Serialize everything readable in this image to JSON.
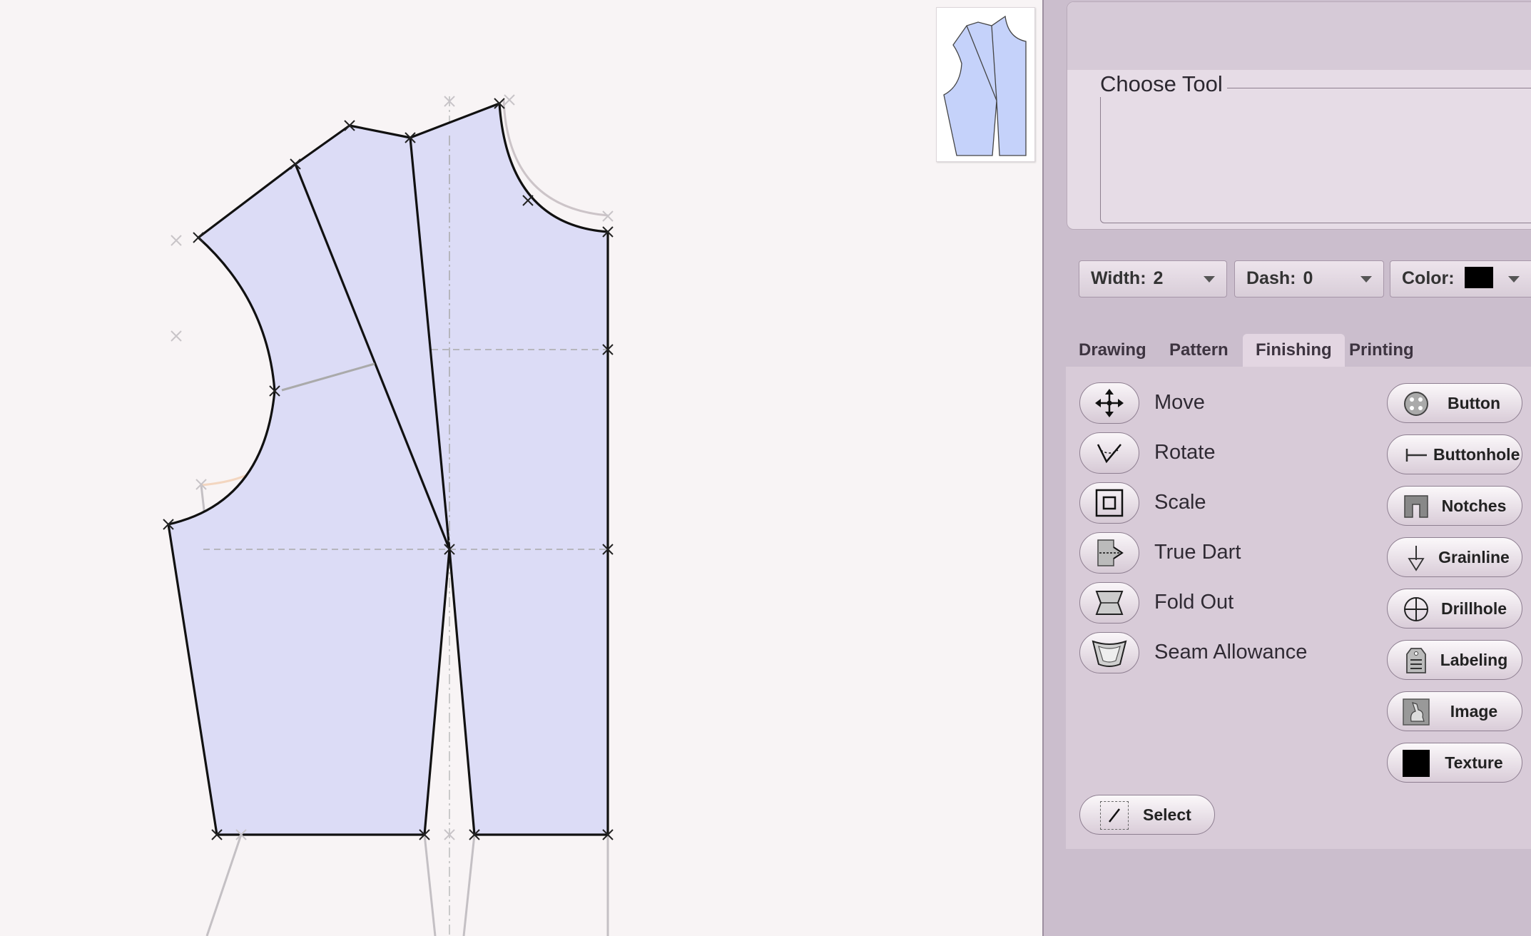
{
  "toolbox": {
    "title": "Choose Tool"
  },
  "line_style": {
    "width_label": "Width:",
    "width_value": "2",
    "dash_label": "Dash:",
    "dash_value": "0",
    "color_label": "Color:",
    "color_value": "#000000"
  },
  "tabs": [
    {
      "label": "Drawing",
      "active": false
    },
    {
      "label": "Pattern",
      "active": false
    },
    {
      "label": "Finishing",
      "active": true
    },
    {
      "label": "Printing",
      "active": false
    }
  ],
  "tools": [
    {
      "label": "Move",
      "icon": "move-icon"
    },
    {
      "label": "Rotate",
      "icon": "rotate-icon"
    },
    {
      "label": "Scale",
      "icon": "scale-icon"
    },
    {
      "label": "True Dart",
      "icon": "true-dart-icon"
    },
    {
      "label": "Fold Out",
      "icon": "fold-out-icon"
    },
    {
      "label": "Seam Allowance",
      "icon": "seam-allowance-icon"
    }
  ],
  "finishing_buttons": [
    {
      "label": "Button",
      "icon": "button-icon"
    },
    {
      "label": "Buttonhole",
      "icon": "buttonhole-icon"
    },
    {
      "label": "Notches",
      "icon": "notches-icon"
    },
    {
      "label": "Grainline",
      "icon": "grainline-icon"
    },
    {
      "label": "Drillhole",
      "icon": "drillhole-icon"
    },
    {
      "label": "Labeling",
      "icon": "labeling-icon"
    },
    {
      "label": "Image",
      "icon": "image-icon"
    },
    {
      "label": "Texture",
      "icon": "texture-icon"
    }
  ],
  "select_button": {
    "label": "Select",
    "icon": "select-icon"
  },
  "colors": {
    "pattern_fill": "#dcdcf6",
    "thumbnail_fill": "#c5d2fa",
    "canvas_bg": "#f8f4f5",
    "panel_bg": "#cbbecd"
  }
}
